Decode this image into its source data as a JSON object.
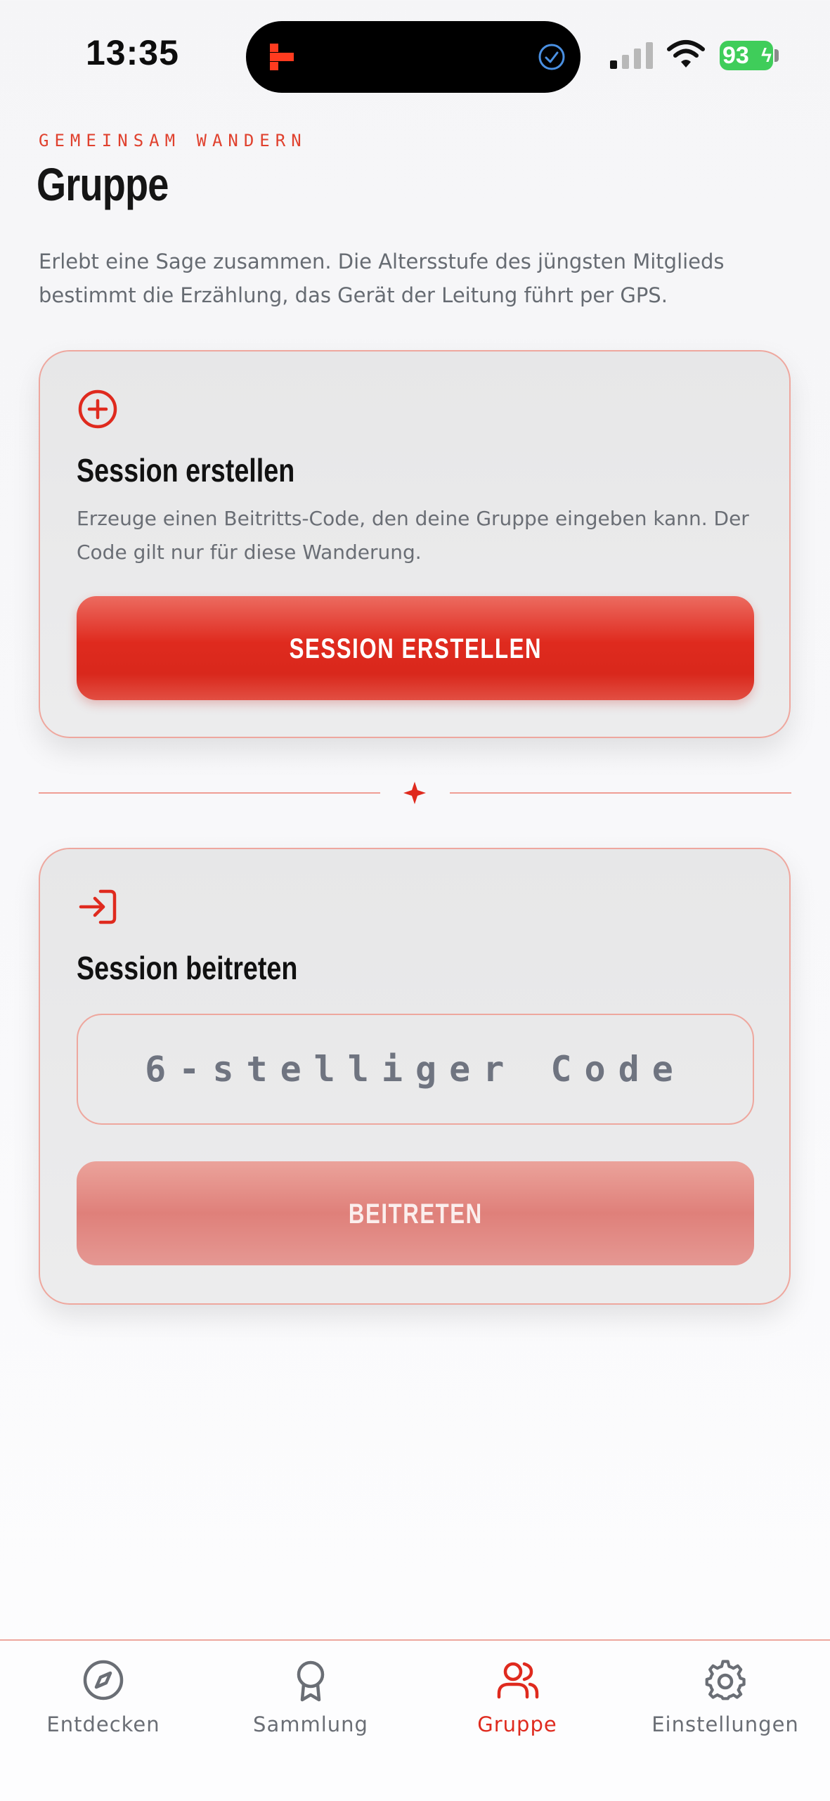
{
  "status_bar": {
    "time": "13:35",
    "battery": "93"
  },
  "header": {
    "eyebrow": "GEMEINSAM WANDERN",
    "title": "Gruppe",
    "intro": "Erlebt eine Sage zusammen. Die Altersstufe des jüngsten Mitglieds bestimmt die Erzählung, das Gerät der Leitung führt per GPS."
  },
  "create_card": {
    "icon": "plus-circle-icon",
    "title": "Session erstellen",
    "description": "Erzeuge einen Beitritts-Code, den deine Gruppe eingeben kann. Der Code gilt nur für diese Wanderung.",
    "button_label": "SESSION ERSTELLEN"
  },
  "join_card": {
    "icon": "login-arrow-icon",
    "title": "Session beitreten",
    "code_placeholder": "6-stelliger Code",
    "button_label": "BEITRETEN"
  },
  "tabs": [
    {
      "label": "Entdecken",
      "icon": "compass-icon",
      "active": false
    },
    {
      "label": "Sammlung",
      "icon": "award-icon",
      "active": false
    },
    {
      "label": "Gruppe",
      "icon": "users-icon",
      "active": true
    },
    {
      "label": "Einstellungen",
      "icon": "gear-icon",
      "active": false
    }
  ],
  "colors": {
    "accent": "#df2a1e",
    "accent_disabled": "#e08a84",
    "card_border": "#eea79e",
    "text_muted": "#6a6e75"
  }
}
